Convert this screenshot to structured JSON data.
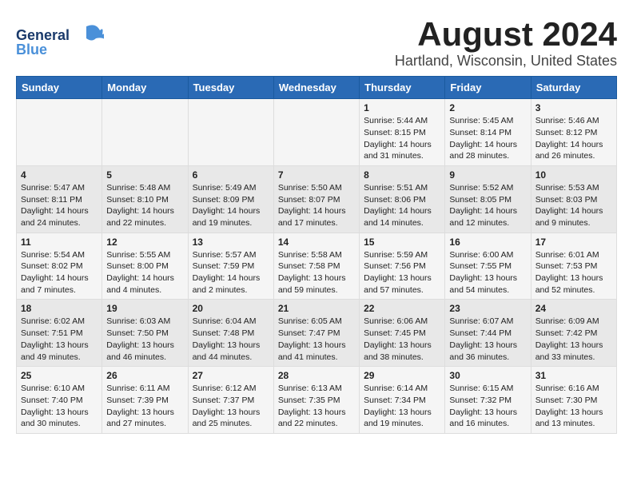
{
  "logo": {
    "line1": "General",
    "line2": "Blue"
  },
  "header": {
    "title": "August 2024",
    "subtitle": "Hartland, Wisconsin, United States"
  },
  "weekdays": [
    "Sunday",
    "Monday",
    "Tuesday",
    "Wednesday",
    "Thursday",
    "Friday",
    "Saturday"
  ],
  "weeks": [
    [
      null,
      null,
      null,
      null,
      {
        "day": 1,
        "sunrise": "5:44 AM",
        "sunset": "8:15 PM",
        "daylight": "14 hours and 31 minutes."
      },
      {
        "day": 2,
        "sunrise": "5:45 AM",
        "sunset": "8:14 PM",
        "daylight": "14 hours and 28 minutes."
      },
      {
        "day": 3,
        "sunrise": "5:46 AM",
        "sunset": "8:12 PM",
        "daylight": "14 hours and 26 minutes."
      }
    ],
    [
      {
        "day": 4,
        "sunrise": "5:47 AM",
        "sunset": "8:11 PM",
        "daylight": "14 hours and 24 minutes."
      },
      {
        "day": 5,
        "sunrise": "5:48 AM",
        "sunset": "8:10 PM",
        "daylight": "14 hours and 22 minutes."
      },
      {
        "day": 6,
        "sunrise": "5:49 AM",
        "sunset": "8:09 PM",
        "daylight": "14 hours and 19 minutes."
      },
      {
        "day": 7,
        "sunrise": "5:50 AM",
        "sunset": "8:07 PM",
        "daylight": "14 hours and 17 minutes."
      },
      {
        "day": 8,
        "sunrise": "5:51 AM",
        "sunset": "8:06 PM",
        "daylight": "14 hours and 14 minutes."
      },
      {
        "day": 9,
        "sunrise": "5:52 AM",
        "sunset": "8:05 PM",
        "daylight": "14 hours and 12 minutes."
      },
      {
        "day": 10,
        "sunrise": "5:53 AM",
        "sunset": "8:03 PM",
        "daylight": "14 hours and 9 minutes."
      }
    ],
    [
      {
        "day": 11,
        "sunrise": "5:54 AM",
        "sunset": "8:02 PM",
        "daylight": "14 hours and 7 minutes."
      },
      {
        "day": 12,
        "sunrise": "5:55 AM",
        "sunset": "8:00 PM",
        "daylight": "14 hours and 4 minutes."
      },
      {
        "day": 13,
        "sunrise": "5:57 AM",
        "sunset": "7:59 PM",
        "daylight": "14 hours and 2 minutes."
      },
      {
        "day": 14,
        "sunrise": "5:58 AM",
        "sunset": "7:58 PM",
        "daylight": "13 hours and 59 minutes."
      },
      {
        "day": 15,
        "sunrise": "5:59 AM",
        "sunset": "7:56 PM",
        "daylight": "13 hours and 57 minutes."
      },
      {
        "day": 16,
        "sunrise": "6:00 AM",
        "sunset": "7:55 PM",
        "daylight": "13 hours and 54 minutes."
      },
      {
        "day": 17,
        "sunrise": "6:01 AM",
        "sunset": "7:53 PM",
        "daylight": "13 hours and 52 minutes."
      }
    ],
    [
      {
        "day": 18,
        "sunrise": "6:02 AM",
        "sunset": "7:51 PM",
        "daylight": "13 hours and 49 minutes."
      },
      {
        "day": 19,
        "sunrise": "6:03 AM",
        "sunset": "7:50 PM",
        "daylight": "13 hours and 46 minutes."
      },
      {
        "day": 20,
        "sunrise": "6:04 AM",
        "sunset": "7:48 PM",
        "daylight": "13 hours and 44 minutes."
      },
      {
        "day": 21,
        "sunrise": "6:05 AM",
        "sunset": "7:47 PM",
        "daylight": "13 hours and 41 minutes."
      },
      {
        "day": 22,
        "sunrise": "6:06 AM",
        "sunset": "7:45 PM",
        "daylight": "13 hours and 38 minutes."
      },
      {
        "day": 23,
        "sunrise": "6:07 AM",
        "sunset": "7:44 PM",
        "daylight": "13 hours and 36 minutes."
      },
      {
        "day": 24,
        "sunrise": "6:09 AM",
        "sunset": "7:42 PM",
        "daylight": "13 hours and 33 minutes."
      }
    ],
    [
      {
        "day": 25,
        "sunrise": "6:10 AM",
        "sunset": "7:40 PM",
        "daylight": "13 hours and 30 minutes."
      },
      {
        "day": 26,
        "sunrise": "6:11 AM",
        "sunset": "7:39 PM",
        "daylight": "13 hours and 27 minutes."
      },
      {
        "day": 27,
        "sunrise": "6:12 AM",
        "sunset": "7:37 PM",
        "daylight": "13 hours and 25 minutes."
      },
      {
        "day": 28,
        "sunrise": "6:13 AM",
        "sunset": "7:35 PM",
        "daylight": "13 hours and 22 minutes."
      },
      {
        "day": 29,
        "sunrise": "6:14 AM",
        "sunset": "7:34 PM",
        "daylight": "13 hours and 19 minutes."
      },
      {
        "day": 30,
        "sunrise": "6:15 AM",
        "sunset": "7:32 PM",
        "daylight": "13 hours and 16 minutes."
      },
      {
        "day": 31,
        "sunrise": "6:16 AM",
        "sunset": "7:30 PM",
        "daylight": "13 hours and 13 minutes."
      }
    ]
  ]
}
